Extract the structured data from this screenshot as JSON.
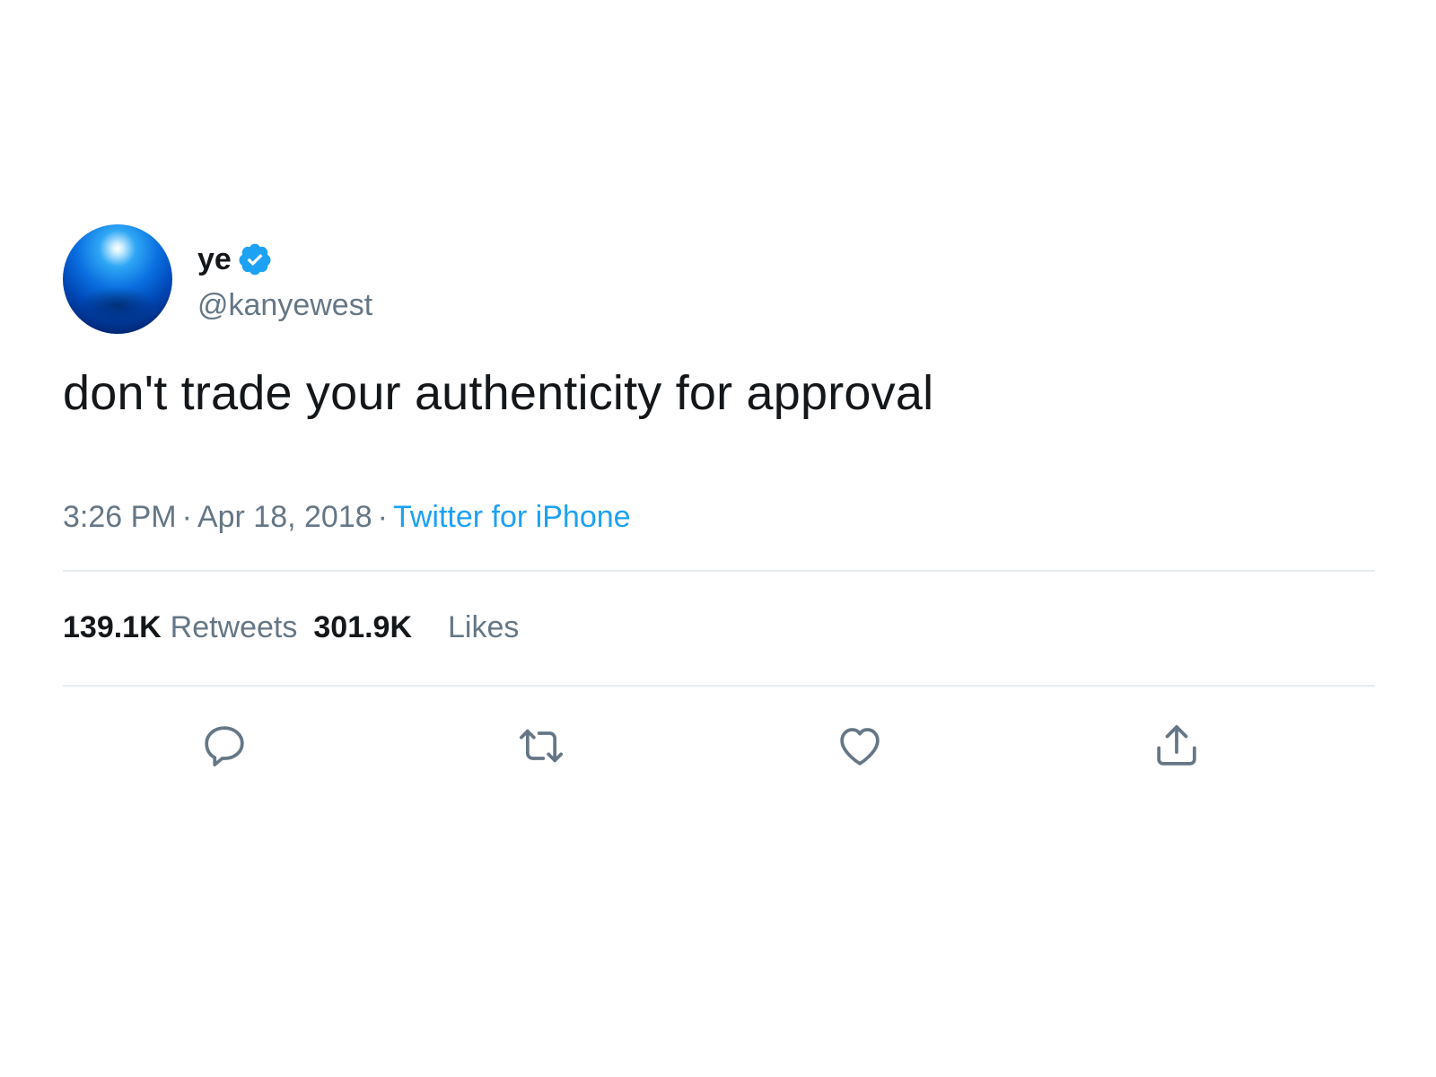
{
  "author": {
    "display_name": "ye",
    "handle": "@kanyewest",
    "verified": true,
    "avatar_icon": "blue-sphere-avatar"
  },
  "tweet": {
    "text": "don't trade your authenticity for approval",
    "time": "3:26 PM",
    "separator": "·",
    "date": "Apr 18, 2018",
    "source": "Twitter for iPhone"
  },
  "stats": {
    "retweets_count": "139.1K",
    "retweets_label": "Retweets",
    "likes_count": "301.9K",
    "likes_label": "Likes"
  },
  "actions": [
    {
      "name": "reply",
      "icon": "reply-icon"
    },
    {
      "name": "retweet",
      "icon": "retweet-icon"
    },
    {
      "name": "like",
      "icon": "heart-icon"
    },
    {
      "name": "share",
      "icon": "share-icon"
    }
  ],
  "colors": {
    "text_primary": "#14171a",
    "text_secondary": "#657786",
    "accent": "#1da1f2",
    "divider": "#e6ecf0"
  }
}
